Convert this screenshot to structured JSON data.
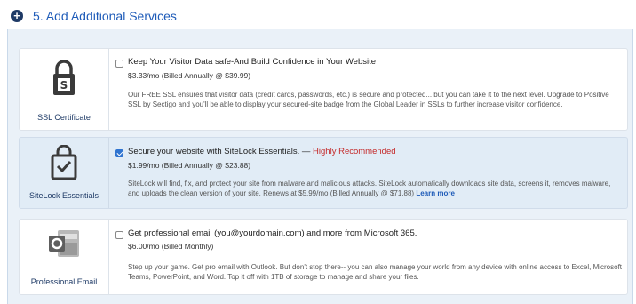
{
  "section": {
    "title": "5. Add Additional Services"
  },
  "services": [
    {
      "label": "SSL Certificate",
      "icon": "padlock-icon",
      "checked": false,
      "headline": "Keep Your Visitor Data safe-And Build Confidence in Your Website",
      "recommended": "",
      "price": "$3.33/mo (Billed Annually @ $39.99)",
      "description": "Our FREE SSL ensures that visitor data (credit cards, passwords, etc.) is secure and protected... but you can take it to the next level. Upgrade to Positive SSL by Sectigo and you'll be able to display your secured-site badge from the Global Leader in SSLs to further increase visitor confidence.",
      "link": ""
    },
    {
      "label": "SiteLock Essentials",
      "icon": "sitelock-shield-icon",
      "checked": true,
      "headline": "Secure your website with SiteLock Essentials. — ",
      "recommended": "Highly Recommended",
      "price": "$1.99/mo (Billed Annually @ $23.88)",
      "description": "SiteLock will find, fix, and protect your site from malware and malicious attacks. SiteLock automatically downloads site data, screens it, removes malware, and uploads the clean version of your site. Renews at $5.99/mo (Billed Annually @ $71.88)",
      "link": "Learn more"
    },
    {
      "label": "Professional Email",
      "icon": "outlook-icon",
      "checked": false,
      "headline": "Get professional email (you@yourdomain.com) and more from Microsoft 365.",
      "recommended": "",
      "price": "$6.00/mo (Billed Monthly)",
      "description": "Step up your game. Get pro email with Outlook. But don't stop there-- you can also manage your world from any device with online access to Excel, Microsoft Teams, PowerPoint, and Word. Top it off with 1TB of storage to manage and share your files.",
      "link": ""
    }
  ],
  "colors": {
    "accent": "#1e5bb8",
    "navy": "#1e3a66",
    "recommended": "#c42a2a",
    "selected_bg": "#e1ecf6"
  }
}
